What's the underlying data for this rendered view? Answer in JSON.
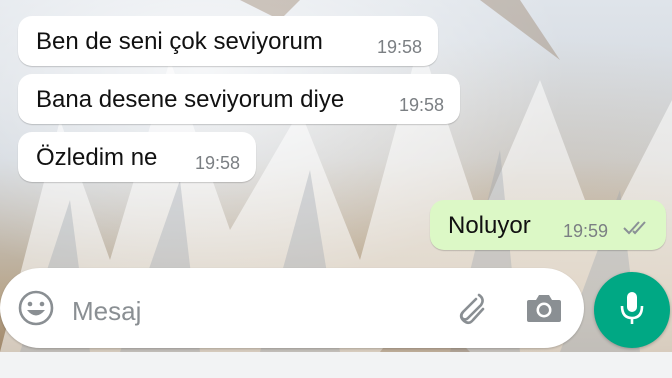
{
  "messages": [
    {
      "text": "Ben de seni çok seviyorum",
      "time": "19:58",
      "direction": "incoming"
    },
    {
      "text": "Bana desene seviyorum diye",
      "time": "19:58",
      "direction": "incoming"
    },
    {
      "text": "Özledim ne",
      "time": "19:58",
      "direction": "incoming"
    },
    {
      "text": "Noluyor",
      "time": "19:59",
      "direction": "outgoing",
      "status": "delivered-double-tick"
    }
  ],
  "composer": {
    "placeholder": "Mesaj",
    "icons": [
      "emoji-icon",
      "attach-icon",
      "camera-icon",
      "mic-icon"
    ]
  },
  "colors": {
    "incoming_bubble": "#ffffff",
    "outgoing_bubble": "#dcf8c6",
    "accent": "#00a884",
    "timestamp": "#7b7f83"
  }
}
